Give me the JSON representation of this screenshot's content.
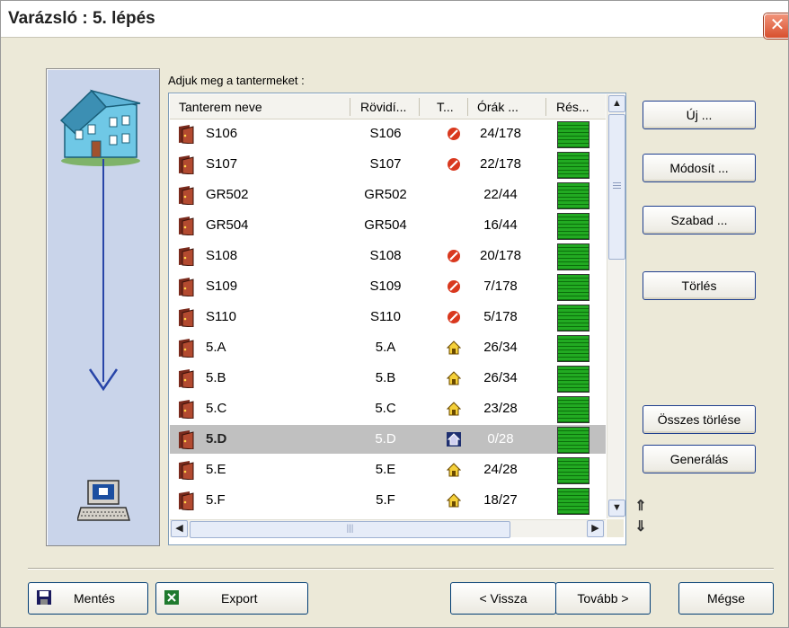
{
  "window": {
    "title": "Varázsló : 5. lépés",
    "close_label": "✕"
  },
  "prompt": "Adjuk meg a tantermeket :",
  "columns": [
    "Tanterem neve",
    "Rövidí...",
    "T...",
    "Órák ...",
    "Rés..."
  ],
  "rows": [
    {
      "name": "S106",
      "short": "S106",
      "type": "no",
      "hours": "24/178"
    },
    {
      "name": "S107",
      "short": "S107",
      "type": "no",
      "hours": "22/178"
    },
    {
      "name": "GR502",
      "short": "GR502",
      "type": "",
      "hours": "22/44"
    },
    {
      "name": "GR504",
      "short": "GR504",
      "type": "",
      "hours": "16/44"
    },
    {
      "name": "S108",
      "short": "S108",
      "type": "no",
      "hours": "20/178"
    },
    {
      "name": "S109",
      "short": "S109",
      "type": "no",
      "hours": "7/178"
    },
    {
      "name": "S110",
      "short": "S110",
      "type": "no",
      "hours": "5/178"
    },
    {
      "name": "5.A",
      "short": "5.A",
      "type": "home",
      "hours": "26/34"
    },
    {
      "name": "5.B",
      "short": "5.B",
      "type": "home",
      "hours": "26/34"
    },
    {
      "name": "5.C",
      "short": "5.C",
      "type": "home",
      "hours": "23/28"
    },
    {
      "name": "5.D",
      "short": "5.D",
      "type": "home",
      "hours": "0/28",
      "selected": true
    },
    {
      "name": "5.E",
      "short": "5.E",
      "type": "home",
      "hours": "24/28"
    },
    {
      "name": "5.F",
      "short": "5.F",
      "type": "home",
      "hours": "18/27"
    }
  ],
  "side_buttons": {
    "new": "Új ...",
    "modify": "Módosít ...",
    "free": "Szabad ...",
    "delete": "Törlés",
    "delete_all": "Összes törlése",
    "generate": "Generálás"
  },
  "bottom_buttons": {
    "save": "Mentés",
    "export": "Export",
    "back": "< Vissza",
    "next": "Tovább >",
    "cancel": "Mégse"
  },
  "icons": {
    "room": "door-icon",
    "no": "forbidden-icon",
    "home": "home-icon"
  },
  "colors": {
    "availability_bar": "#22aa22",
    "forbidden": "#d9381e",
    "selected_row": "#c0c0c0",
    "arrow": "#2845a8"
  }
}
